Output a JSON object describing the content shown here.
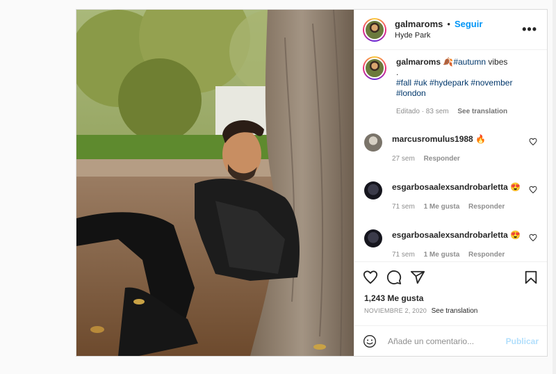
{
  "post": {
    "username": "galmaroms",
    "follow_label": "Seguir",
    "dot": "•",
    "location": "Hyde Park",
    "more_label": "•••",
    "caption": {
      "username": "galmaroms",
      "emoji": "🍂",
      "line1_tag": "#autumn",
      "line1_text": " vibes",
      "line2": ".",
      "hashtags": "#fall #uk #hydepark #november #london",
      "edited": "Editado · 83 sem",
      "see_translation": "See translation"
    },
    "comments": [
      {
        "username": "marcusromulus1988",
        "text": " 🔥",
        "time": "27 sem",
        "likes": "",
        "reply": "Responder"
      },
      {
        "username": "esgarbosaalexsandrobarletta",
        "text": " 😍",
        "time": "71 sem",
        "likes": "1 Me gusta",
        "reply": "Responder"
      },
      {
        "username": "esgarbosaalexsandrobarletta",
        "text": " 😍",
        "time": "71 sem",
        "likes": "1 Me gusta",
        "reply": "Responder"
      }
    ],
    "likes_count": "1,243 Me gusta",
    "date": "NOVIEMBRE 2, 2020",
    "date_translation": "See translation",
    "comment_placeholder": "Añade un comentario...",
    "publish_label": "Publicar"
  },
  "colors": {
    "accent": "#0095f6",
    "publish_disabled": "#b2dffc",
    "hashtag": "#00376b",
    "muted": "#8e8e8e"
  },
  "icons": [
    "more-icon",
    "heart-icon",
    "comment-icon",
    "share-icon",
    "bookmark-icon",
    "emoji-icon"
  ]
}
